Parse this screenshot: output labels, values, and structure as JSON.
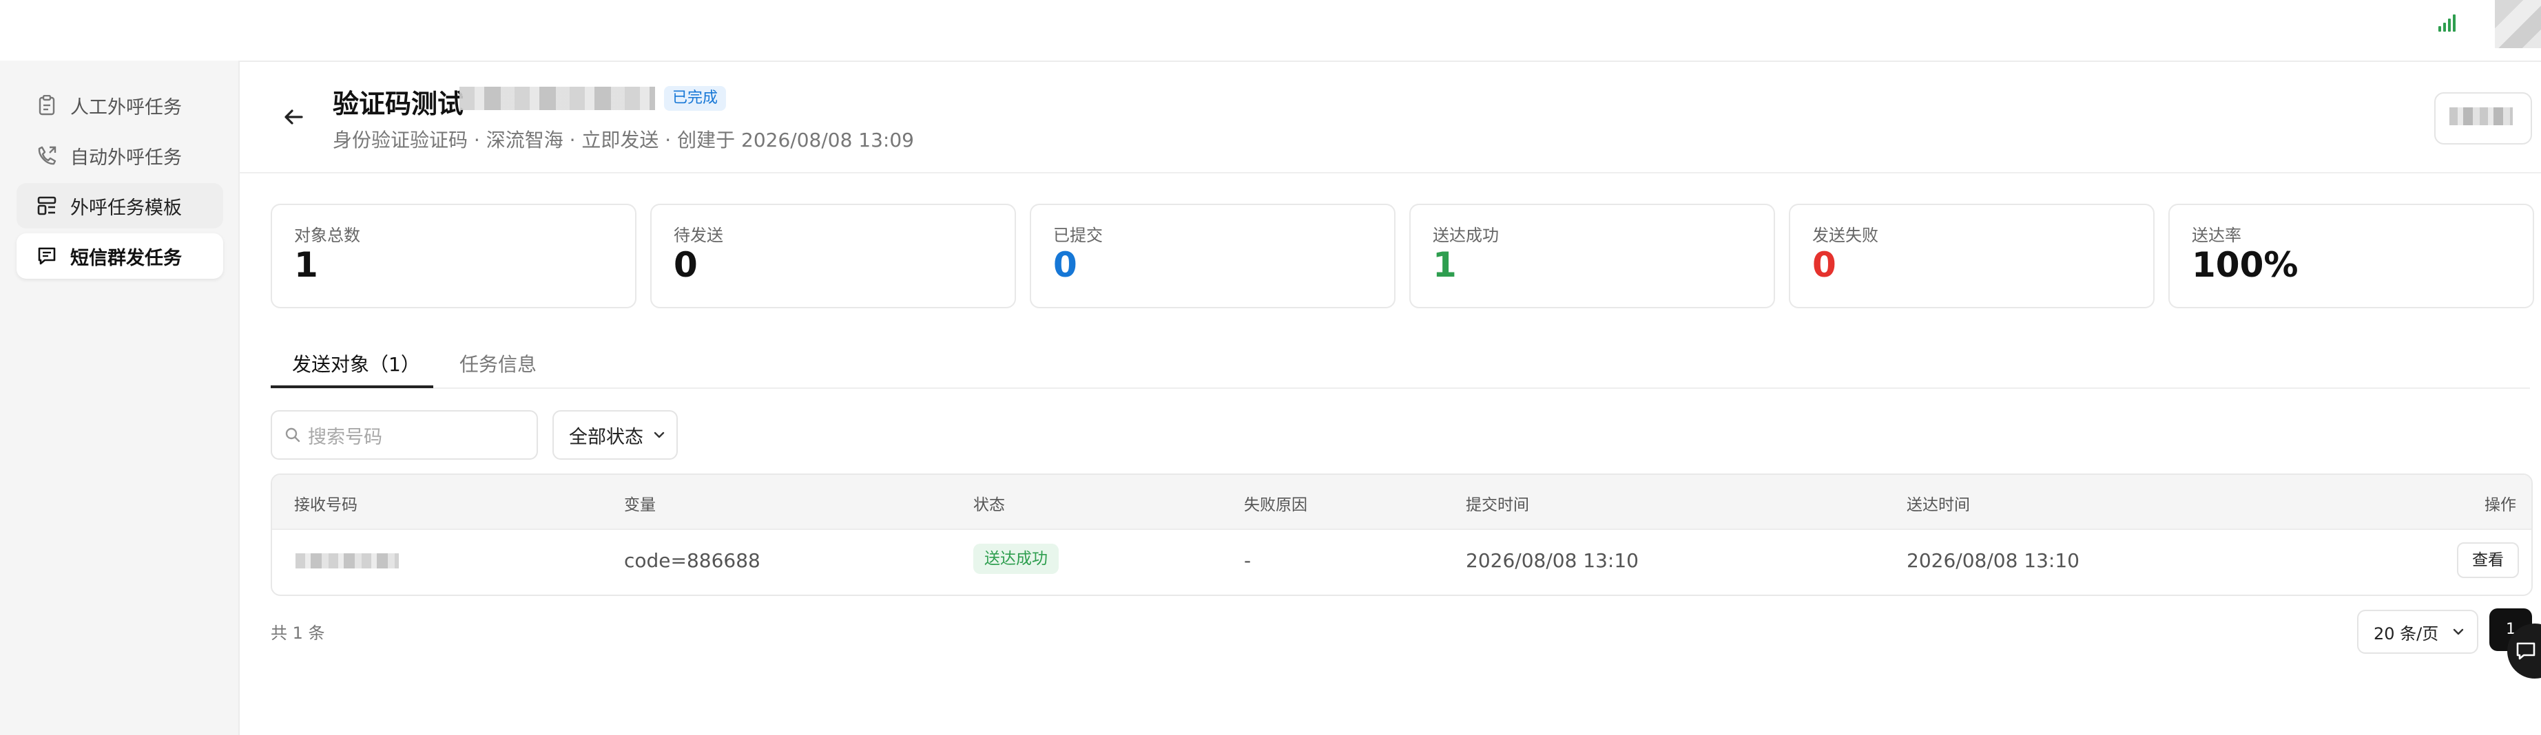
{
  "sidebar": {
    "items": [
      {
        "label": "人工外呼任务",
        "icon": "clipboard-icon"
      },
      {
        "label": "自动外呼任务",
        "icon": "phone-icon"
      },
      {
        "label": "外呼任务模板",
        "icon": "template-icon"
      },
      {
        "label": "短信群发任务",
        "icon": "message-icon"
      }
    ],
    "active_index": 3
  },
  "header": {
    "title": "验证码测试",
    "status": "已完成",
    "subtitle": "身份验证验证码 · 深流智海 · 立即发送 · 创建于 2026/08/08 13:09"
  },
  "stats": [
    {
      "label": "对象总数",
      "value": "1",
      "color": "#111111"
    },
    {
      "label": "待发送",
      "value": "0",
      "color": "#111111"
    },
    {
      "label": "已提交",
      "value": "0",
      "color": "#1677d6"
    },
    {
      "label": "送达成功",
      "value": "1",
      "color": "#2e9e4f"
    },
    {
      "label": "发送失败",
      "value": "0",
      "color": "#e5322d"
    },
    {
      "label": "送达率",
      "value": "100%",
      "color": "#111111"
    }
  ],
  "tabs": [
    {
      "label": "发送对象（1）"
    },
    {
      "label": "任务信息"
    }
  ],
  "filters": {
    "search_placeholder": "搜索号码",
    "status_select": "全部状态"
  },
  "table": {
    "columns": [
      "接收号码",
      "变量",
      "状态",
      "失败原因",
      "提交时间",
      "送达时间",
      "操作"
    ],
    "rows": [
      {
        "variable": "code=886688",
        "status": "送达成功",
        "reason": "-",
        "submit_time": "2026/08/08 13:10",
        "deliver_time": "2026/08/08 13:10",
        "action": "查看"
      }
    ]
  },
  "pagination": {
    "total": "共 1 条",
    "page_size": "20 条/页",
    "current_page": "1"
  },
  "colors": {
    "accent_blue": "#1677d6",
    "success_green": "#2e9e4f",
    "danger_red": "#e5322d"
  }
}
